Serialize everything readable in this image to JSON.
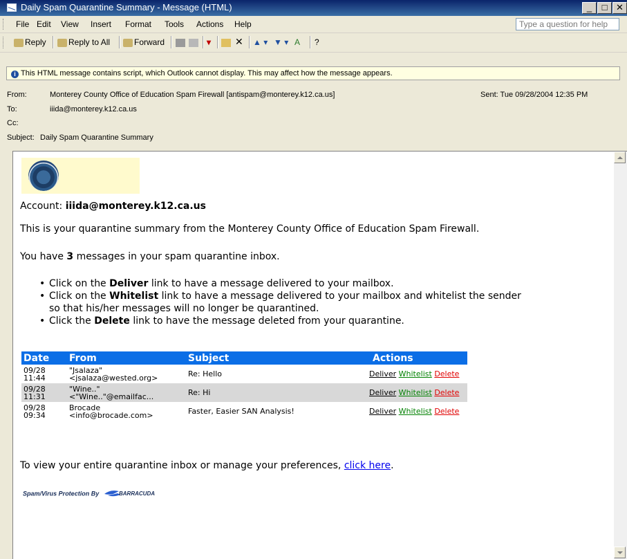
{
  "window": {
    "title": "Daily Spam Quarantine Summary - Message (HTML)",
    "minimize": "_",
    "maximize": "□",
    "close": "✕"
  },
  "menu": {
    "items": [
      "File",
      "Edit",
      "View",
      "Insert",
      "Format",
      "Tools",
      "Actions",
      "Help"
    ],
    "help_placeholder": "Type a question for help"
  },
  "toolbar": {
    "reply": "Reply",
    "reply_all": "Reply to All",
    "forward": "Forward"
  },
  "infobar": {
    "text": "This HTML message contains script, which Outlook cannot display.  This may affect how the message appears."
  },
  "header": {
    "from_label": "From:",
    "from": "Monterey County Office of Education Spam Firewall [antispam@monterey.k12.ca.us]",
    "to_label": "To:",
    "to": "iiida@monterey.k12.ca.us",
    "cc_label": "Cc:",
    "cc": "",
    "subject_label": "Subject:",
    "subject": "Daily Spam Quarantine Summary",
    "sent_label": "Sent:",
    "sent": "Tue 09/28/2004 12:35 PM"
  },
  "message": {
    "account_label": "Account:",
    "account": "iiida@monterey.k12.ca.us",
    "intro": "This is your quarantine summary from the Monterey County Office of Education Spam Firewall.",
    "count_pre": "You have",
    "count": "3",
    "count_post": "messages in your spam quarantine inbox.",
    "b1_pre": "Click on the",
    "b1_word": "Deliver",
    "b1_post": "link to have a message delivered to your mailbox.",
    "b2_pre": "Click on the",
    "b2_word": "Whitelist",
    "b2_post": "link to have a message delivered to your mailbox and whitelist the sender",
    "b2_cont": "so that his/her messages will no longer be quarantined.",
    "b3_pre": "Click the",
    "b3_word": "Delete",
    "b3_post": "link to have the message deleted from your quarantine.",
    "view_text": "To view your entire quarantine inbox or manage your preferences,",
    "view_link": "click here",
    "view_end": ".",
    "footer": "Spam/Virus Protection By",
    "footer_logo": "BARRACUDA"
  },
  "table": {
    "headers": [
      "Date",
      "From",
      "Subject",
      "Actions"
    ],
    "actions": {
      "deliver": "Deliver",
      "whitelist": "Whitelist",
      "delete": "Delete"
    },
    "rows": [
      {
        "date1": "09/28",
        "date2": "11:44",
        "from1": "\"Jsalaza\"",
        "from2": "<jsalaza@wested.org>",
        "subject": "Re: Hello"
      },
      {
        "date1": "09/28",
        "date2": "11:31",
        "from1": "\"Wine..\"",
        "from2": "<\"Wine..\"@emailfac...",
        "subject": "Re: Hi"
      },
      {
        "date1": "09/28",
        "date2": "09:34",
        "from1": "Brocade",
        "from2": "<info@brocade.com>",
        "subject": "Faster, Easier SAN Analysis!"
      }
    ]
  }
}
